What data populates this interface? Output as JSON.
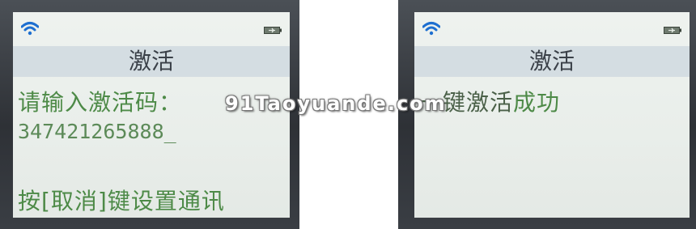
{
  "left_screen": {
    "title": "激活",
    "prompt": "请输入激活码：",
    "code_value": "347421265888_",
    "footer_hint": "按[取消]键设置通讯",
    "wifi_icon": "wifi-icon",
    "battery_icon": "battery-icon"
  },
  "right_screen": {
    "title": "激活",
    "message_prefix": "一键激活",
    "message_suffix": "成功",
    "wifi_icon": "wifi-icon",
    "battery_icon": "battery-icon"
  },
  "watermark": "91Taoyuande.com",
  "colors": {
    "screen_bg": "#eaefeb",
    "title_bar": "#d4dde2",
    "text_green": "#4d8a47",
    "wifi_blue": "#1e6fd0",
    "bezel": "#2e3136"
  }
}
